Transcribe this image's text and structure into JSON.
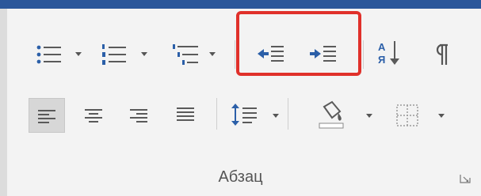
{
  "ribbon": {
    "group_label": "Абзац",
    "icons": {
      "bullets": "bullets-icon",
      "numbering": "numbering-icon",
      "multilevel": "multilevel-list-icon",
      "decrease_indent": "decrease-indent-icon",
      "increase_indent": "increase-indent-icon",
      "sort": "sort-icon",
      "show_marks": "pilcrow-icon",
      "align_left": "align-left-icon",
      "center": "align-center-icon",
      "align_right": "align-right-icon",
      "justify": "justify-icon",
      "line_spacing": "line-spacing-icon",
      "shading": "shading-icon",
      "borders": "borders-icon",
      "dialog_launcher": "dialog-launcher-icon"
    },
    "colors": {
      "title_bar": "#2b579a",
      "highlight": "#e0302a",
      "icon_blue": "#2b5fa8"
    }
  }
}
